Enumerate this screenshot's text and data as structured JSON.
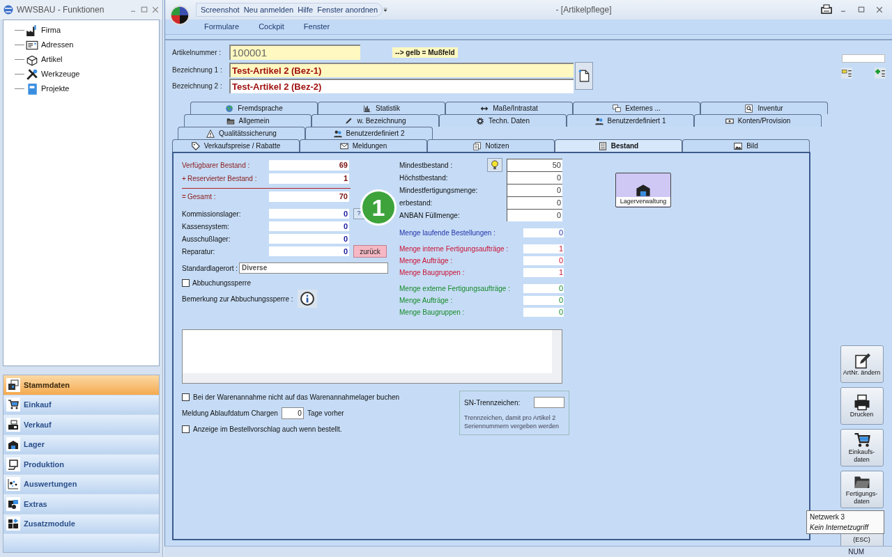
{
  "left_window": {
    "title": "WWSBAU - Funktionen",
    "tree": [
      {
        "label": "Firma",
        "kind": "factory"
      },
      {
        "label": "Adressen",
        "kind": "card"
      },
      {
        "label": "Artikel",
        "kind": "box"
      },
      {
        "label": "Werkzeuge",
        "kind": "tools"
      },
      {
        "label": "Projekte",
        "kind": "book"
      }
    ],
    "nav": [
      {
        "label": "Stammdaten",
        "selected": true,
        "kind": "windows"
      },
      {
        "label": "Einkauf",
        "selected": false,
        "kind": "cart"
      },
      {
        "label": "Verkauf",
        "selected": false,
        "kind": "register"
      },
      {
        "label": "Lager",
        "selected": false,
        "kind": "warehouse"
      },
      {
        "label": "Produktion",
        "selected": false,
        "kind": "machine"
      },
      {
        "label": "Auswertungen",
        "selected": false,
        "kind": "dots"
      },
      {
        "label": "Extras",
        "selected": false,
        "kind": "puzzle"
      },
      {
        "label": "Zusatzmodule",
        "selected": false,
        "kind": "blocks"
      }
    ]
  },
  "main_window": {
    "title": "- [Artikelpflege]",
    "quick_access": [
      "Screenshot",
      "Neu anmelden",
      "Hilfe",
      "Fenster anordnen"
    ],
    "menu": [
      "Formulare",
      "Cockpit",
      "Fenster"
    ]
  },
  "header": {
    "artikelnummer": {
      "label": "Artikelnummer :",
      "value": "100001"
    },
    "hint": "--> gelb = Mußfeld",
    "bezeichnung": [
      {
        "label": "Bezeichnung 1 :",
        "value": "Test-Artikel 2  (Bez-1)",
        "required": true
      },
      {
        "label": "Bezeichnung 2 :",
        "value": "Test-Artikel 2  (Bez-2)",
        "required": false
      }
    ]
  },
  "tab_rows": [
    [
      {
        "label": "Fremdsprache",
        "selected": false,
        "kind": "globe"
      },
      {
        "label": "Statistik",
        "selected": false,
        "kind": "chart"
      },
      {
        "label": "Maße/Intrastat",
        "selected": false,
        "kind": "arrows"
      },
      {
        "label": "Externes ...",
        "selected": false,
        "kind": "window"
      },
      {
        "label": "Inventur",
        "selected": false,
        "kind": "search"
      }
    ],
    [
      {
        "label": "Allgemein",
        "selected": false,
        "kind": "folder"
      },
      {
        "label": "w. Bezeichnung",
        "selected": false,
        "kind": "pen"
      },
      {
        "label": "Techn. Daten",
        "selected": false,
        "kind": "gear"
      },
      {
        "label": "Benutzerdefiniert 1",
        "selected": false,
        "kind": "users"
      },
      {
        "label": "Konten/Provision",
        "selected": false,
        "kind": "money"
      }
    ],
    [
      {
        "label": "Qualitätssicherung",
        "selected": false,
        "kind": "warning"
      },
      {
        "label": "Benutzerdefiniert 2",
        "selected": false,
        "kind": "users"
      }
    ],
    [
      {
        "label": "Verkaufspreise / Rabatte",
        "selected": false,
        "kind": "tag"
      },
      {
        "label": "Meldungen",
        "selected": false,
        "kind": "mail"
      },
      {
        "label": "Notizen",
        "selected": false,
        "kind": "note"
      },
      {
        "label": "Bestand",
        "selected": true,
        "kind": "list"
      },
      {
        "label": "Bild",
        "selected": false,
        "kind": "picture"
      }
    ]
  ],
  "bestand": {
    "summary": [
      {
        "label": "Verfügbarer Bestand :",
        "value": "69"
      },
      {
        "sign": "+",
        "label": "Reservierter Bestand :",
        "value": "1"
      },
      {
        "sign": "=",
        "label": "Gesamt :",
        "value": "70"
      }
    ],
    "lager": [
      {
        "label": "Kommissionslager:",
        "value": "0",
        "button": {
          "label": "?",
          "kind": "help"
        }
      },
      {
        "label": "Kassensystem:",
        "value": "0"
      },
      {
        "label": "Ausschußlager:",
        "value": "0"
      },
      {
        "label": "Reparatur:",
        "value": "0",
        "button": {
          "label": "zurück",
          "kind": "back"
        }
      }
    ],
    "standardlagerort": {
      "label": "Standardlagerort :",
      "value": "Diverse"
    },
    "abbuchungssperre": {
      "label": "Abbuchungssperre",
      "checked": false
    },
    "bemerkung_label": "Bemerkung zur Abbuchungssperre :",
    "limits": [
      {
        "label": "Mindestbestand :",
        "value": "50"
      },
      {
        "label": "Höchstbestand:",
        "value": "0"
      },
      {
        "label": "Mindestfertigungsmenge:",
        "value": "0"
      },
      {
        "label": "erbestand:",
        "value": "0"
      },
      {
        "label": "ANBAN Füllmenge:",
        "value": "0"
      }
    ],
    "mengen": [
      {
        "kind": "orders",
        "items": [
          {
            "label": "Menge laufende Bestellungen :",
            "value": "0"
          }
        ]
      },
      {
        "kind": "internal",
        "items": [
          {
            "label": "Menge interne Fertigungsaufträge :",
            "value": "1"
          },
          {
            "label": "Menge Aufträge :",
            "value": "0"
          },
          {
            "label": "Menge Baugruppen :",
            "value": "1"
          }
        ]
      },
      {
        "kind": "external",
        "items": [
          {
            "label": "Menge externe Fertigungsaufträge :",
            "value": "0"
          },
          {
            "label": "Menge Aufträge :",
            "value": "0"
          },
          {
            "label": "Menge Baugruppen :",
            "value": "0"
          }
        ]
      }
    ],
    "lagerverwaltung": "Lagerverwaltung",
    "options": [
      {
        "kind": "checkbox",
        "label": "Bei der Warenannahme nicht auf das Warenannahmelager buchen",
        "checked": false
      },
      {
        "kind": "number",
        "label": "Meldung Ablaufdatum Chargen",
        "value": "0",
        "suffix": "Tage vorher"
      },
      {
        "kind": "checkbox",
        "label": "Anzeige im Bestellvorschlag auch wenn bestellt.",
        "checked": false
      }
    ],
    "sn": {
      "label": "SN-Trennzeichen:",
      "note": "Trennzeichen, damit pro Artikel 2 Seriennummern vergeben werden"
    }
  },
  "side_buttons": [
    {
      "label": "ArtNr. ändern",
      "kind": "edit"
    },
    {
      "label": "Drucken",
      "kind": "print"
    },
    {
      "label": "Einkaufs-daten",
      "kind": "cart"
    },
    {
      "label": "Fertigungs-daten",
      "kind": "folder"
    },
    {
      "label": "(ESC)",
      "kind": "exit"
    }
  ],
  "annotation": {
    "number": "1"
  },
  "tooltip": {
    "title": "Netzwerk 3",
    "text": "Kein Internetzugriff"
  },
  "status_bar": {
    "indicator": "NUM"
  }
}
